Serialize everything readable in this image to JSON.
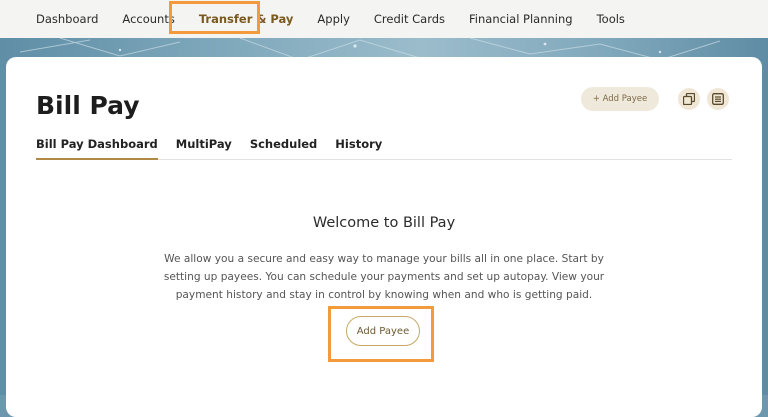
{
  "nav": {
    "items": [
      {
        "label": "Dashboard",
        "active": false
      },
      {
        "label": "Accounts",
        "active": false
      },
      {
        "label": "Transfer & Pay",
        "active": true
      },
      {
        "label": "Apply",
        "active": false
      },
      {
        "label": "Credit Cards",
        "active": false
      },
      {
        "label": "Financial Planning",
        "active": false
      },
      {
        "label": "Tools",
        "active": false
      }
    ]
  },
  "page": {
    "title": "Bill Pay",
    "add_payee_top_label": "+ Add Payee",
    "icons": [
      "copy-icon",
      "list-icon"
    ]
  },
  "tabs": [
    {
      "label": "Bill Pay Dashboard",
      "active": true
    },
    {
      "label": "MultiPay",
      "active": false
    },
    {
      "label": "Scheduled",
      "active": false
    },
    {
      "label": "History",
      "active": false
    }
  ],
  "main": {
    "welcome": "Welcome to Bill Pay",
    "description": "We allow you a secure and easy way to manage your bills all in one place. Start by setting up payees. You can schedule your payments and set up autopay. View your payment history and stay in control by knowing when and who is getting paid.",
    "add_payee_label": "Add Payee"
  },
  "colors": {
    "highlight": "#f39a3c",
    "accent": "#b08a45",
    "background": "#6c97ac"
  }
}
